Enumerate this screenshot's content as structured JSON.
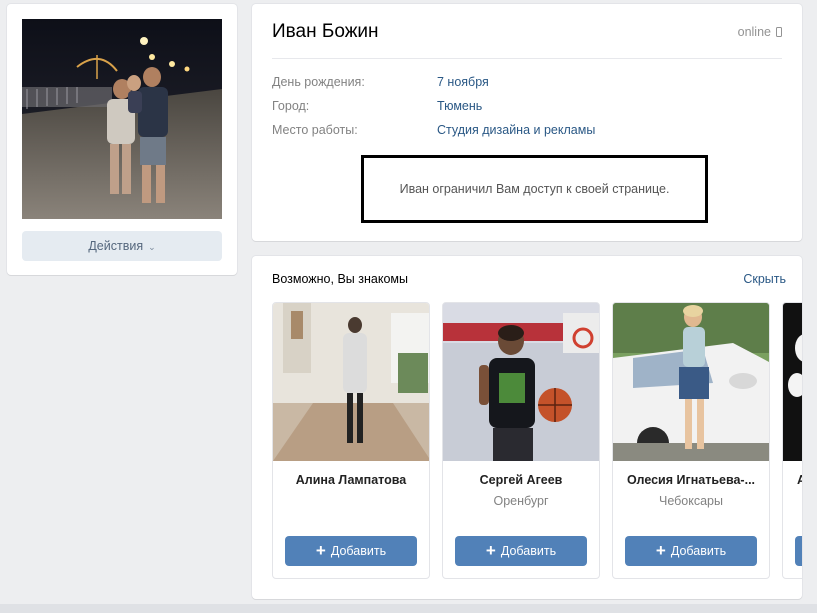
{
  "profile": {
    "name": "Иван Божин",
    "status": "online",
    "actions_label": "Действия",
    "info": [
      {
        "label": "День рождения:",
        "value": "7 ноября"
      },
      {
        "label": "Город:",
        "value": "Тюмень"
      },
      {
        "label": "Место работы:",
        "value": "Студия дизайна и рекламы"
      }
    ],
    "restricted_message": "Иван ограничил Вам доступ к своей странице."
  },
  "suggestions": {
    "title": "Возможно, Вы знакомы",
    "hide_label": "Скрыть",
    "add_label": "Добавить",
    "people": [
      {
        "name": "Алина Лампатова",
        "city": ""
      },
      {
        "name": "Сергей Агеев",
        "city": "Оренбург"
      },
      {
        "name": "Олесия Игнатьева-...",
        "city": "Чебоксары"
      },
      {
        "name": "А",
        "city": ""
      }
    ]
  },
  "colors": {
    "link": "#2a5885",
    "button": "#5181b8",
    "background": "#edeef0"
  }
}
